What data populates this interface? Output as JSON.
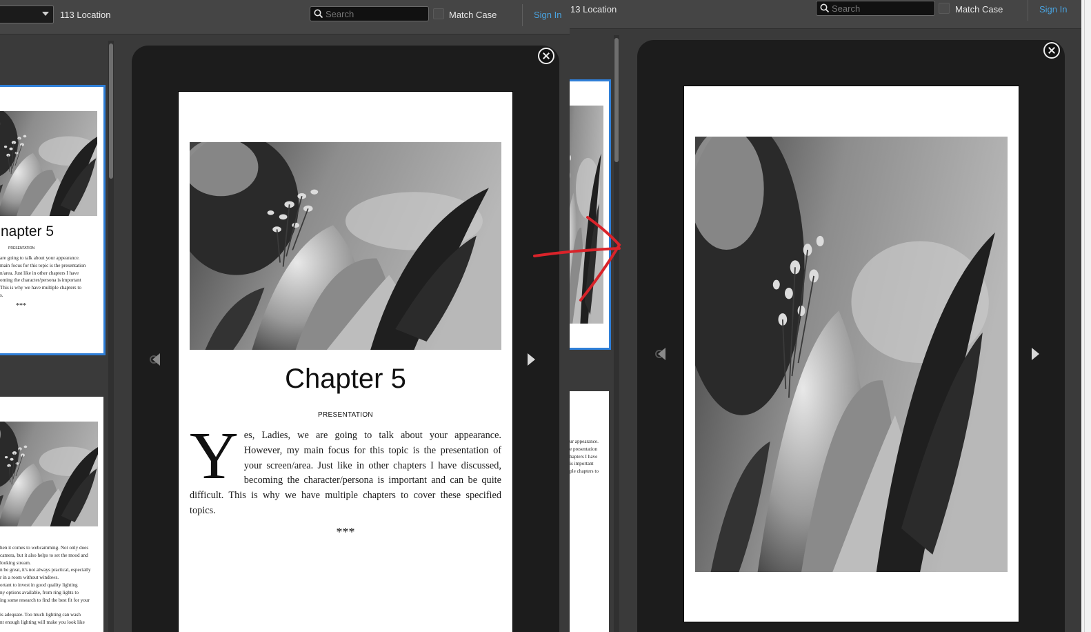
{
  "left_panel": {
    "toolbar": {
      "location_label": "113 Location",
      "search_placeholder": "Search",
      "match_case_label": "Match Case",
      "sign_in_label": "Sign In"
    },
    "thumbnail_1": {
      "title_fragment": "napter 5",
      "subtitle": "PRESENTATION",
      "text_lines": [
        "are going to talk about your appearance.",
        "main focus for this topic is the presentation",
        "n/area. Just like in other chapters I have",
        "oming the character/persona is important",
        "This is why we have multiple chapters to",
        "s."
      ],
      "stars": "***"
    },
    "thumbnail_2": {
      "text_lines": [
        "hen it comes to webcamming. Not only does",
        "camera, but it also helps to set the mood and",
        "looking stream.",
        "n be great, it's not always practical, especially",
        "r in a room without windows.",
        "ortant to invest in good quality lighting",
        "ny options available, from ring lights to",
        "ing some research to find the best fit for your",
        "",
        "is adequate. Too much lighting can wash",
        "nt enough lighting will make you look like"
      ]
    },
    "page": {
      "chapter_title": "Chapter 5",
      "subtitle": "PRESENTATION",
      "drop_cap": "Y",
      "body": "es, Ladies, we are going to talk about your appearance. However, my main focus for this topic is the presentation of your screen/area. Just like in other chapters I have discussed, becoming the character/persona is important and can be quite difficult. This is why we have multiple chapters to cover these specified topics.",
      "stars": "***"
    }
  },
  "right_panel": {
    "toolbar": {
      "location_label": "13 Location",
      "search_placeholder": "Search",
      "match_case_label": "Match Case",
      "sign_in_label": "Sign In"
    },
    "thumbnail_2": {
      "text_lines": [
        "ur appearance.",
        "e presentation",
        "hapters I have",
        "is important",
        "ple chapters to"
      ]
    }
  },
  "icons": {
    "search": "search-icon",
    "close": "close-icon",
    "prev": "prev-page-icon",
    "next": "next-page-icon",
    "annotation": "red-arrow-annotation"
  },
  "colors": {
    "toolbar_bg": "#454545",
    "panel_bg": "#3a3a3a",
    "viewer_bg": "#1c1c1c",
    "accent_link": "#4aa3df",
    "selection_border": "#2f7fd8",
    "annotation_red": "#d9232a"
  }
}
